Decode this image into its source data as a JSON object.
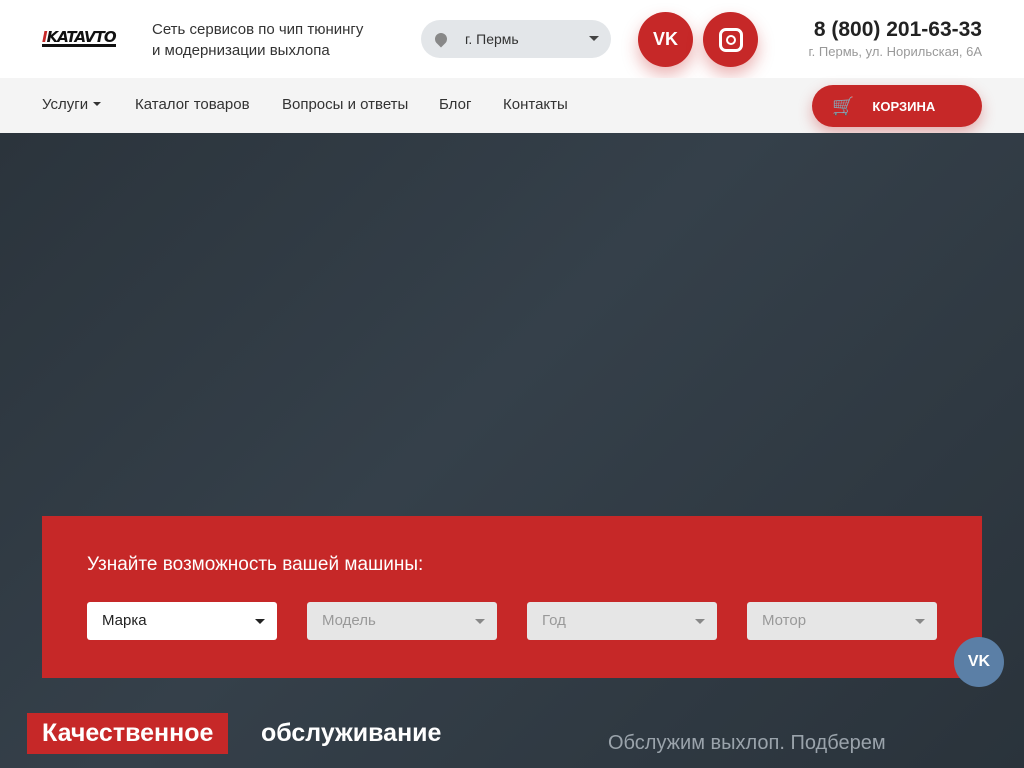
{
  "header": {
    "logo": "KATAVTO",
    "tagline_1": "Сеть сервисов по чип тюнингу",
    "tagline_2": "и модернизации выхлопа",
    "city": "г. Пермь",
    "phone": "8 (800) 201-63-33",
    "address": "г. Пермь, ул. Норильская, 6А",
    "vk_label": "VK"
  },
  "nav": {
    "items": [
      {
        "label": "Услуги"
      },
      {
        "label": "Каталог товаров"
      },
      {
        "label": "Вопросы и ответы"
      },
      {
        "label": "Блог"
      },
      {
        "label": "Контакты"
      }
    ],
    "cart": "КОРЗИНА"
  },
  "selector": {
    "title": "Узнайте возможность вашей машины:",
    "fields": [
      {
        "value": "Марка"
      },
      {
        "placeholder": "Модель"
      },
      {
        "placeholder": "Год"
      },
      {
        "placeholder": "Мотор"
      }
    ]
  },
  "float": {
    "vk": "VK"
  },
  "hero": {
    "badge": "Качественное",
    "headline_rest": "обслуживание",
    "subtext": "Обслужим выхлоп. Подберем"
  },
  "colors": {
    "accent": "#c62828",
    "dark": "#273038"
  }
}
